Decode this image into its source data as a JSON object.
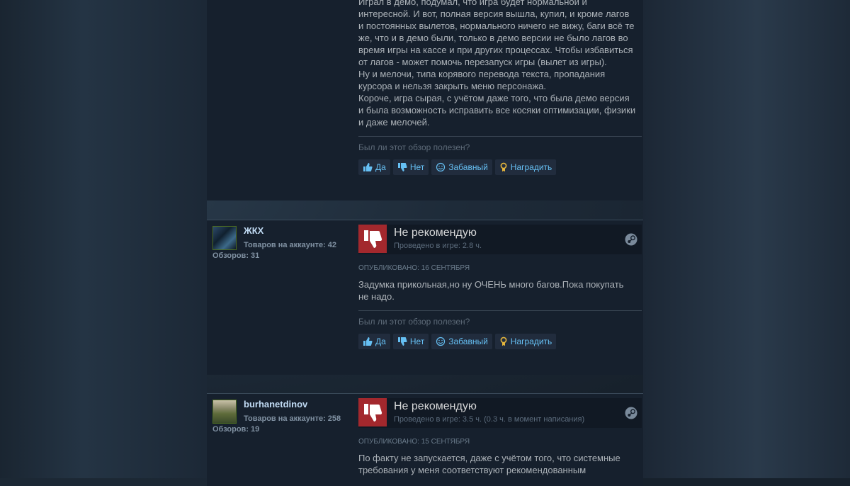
{
  "reviews": [
    {
      "body": "Играл в демо, подумал, что игра будет нормальной и интересной. И вот, полная версия вышла, купил, и кроме лагов и постоянных вылетов, нормального ничего не вижу, баги всё те же, что и в демо были, только в демо версии не было лагов во время игры на кассе и при других процессах. Чтобы избавиться от лагов - может помочь перезапуск игры (вылет из игры).\nНу и мелочи, типа корявого перевода текста, пропадания курсора и нельзя закрыть меню персонажа.\nКороче, игра сырая, с учётом даже того, что была демо версия и была возможность исправить все косяки оптимизации, физики и даже мелочей."
    },
    {
      "username": "ЖКХ",
      "products_label": "Товаров на аккаунте:",
      "products": "42",
      "reviews_label": "Обзоров:",
      "reviews": "31",
      "verdict": "Не рекомендую",
      "hours": "Проведено в игре: 2.8 ч.",
      "posted_label": "Опубликовано:",
      "posted_date": "16 сентября",
      "body": "Задумка прикольная,но ну ОЧЕНЬ много багов.Пока покупать не надо."
    },
    {
      "username": "burhanetdinov",
      "products_label": "Товаров на аккаунте:",
      "products": "258",
      "reviews_label": "Обзоров:",
      "reviews": "19",
      "verdict": "Не рекомендую",
      "hours": "Проведено в игре: 3.5 ч. (0.3 ч. в момент написания)",
      "posted_label": "Опубликовано:",
      "posted_date": "15 сентября",
      "body": "По факту не запускается, даже с учётом того, что системные требования у меня соответствуют рекомендованным"
    }
  ],
  "helpful": {
    "question": "Был ли этот обзор полезен?",
    "yes": "Да",
    "no": "Нет",
    "funny": "Забавный",
    "award": "Наградить"
  },
  "colors": {
    "accent": "#66c0f4",
    "negative": "#a3282d",
    "award": "#e5b53c"
  }
}
